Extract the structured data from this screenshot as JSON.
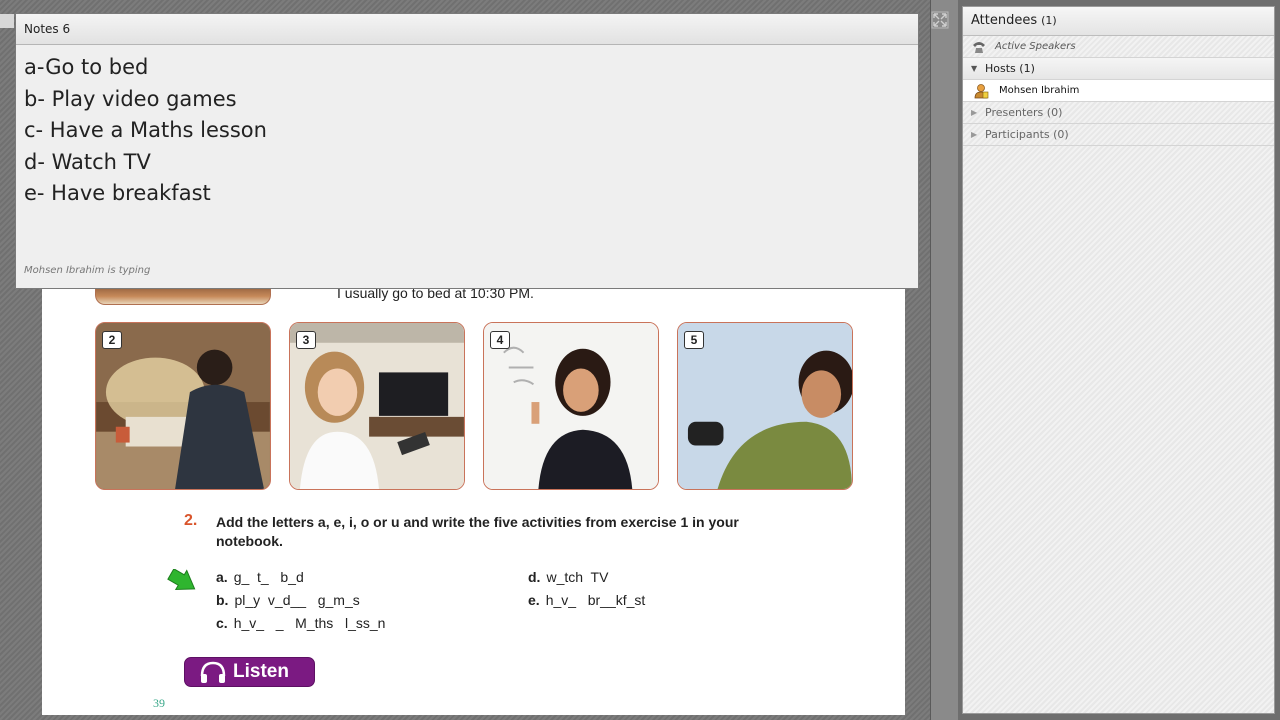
{
  "notes": {
    "title": "Notes 6",
    "lines": [
      "a-Go to bed",
      "b- Play video games",
      "c- Have a Maths lesson",
      "d- Watch TV",
      "e- Have breakfast"
    ],
    "status": "Mohsen  Ibrahim is typing"
  },
  "attendees": {
    "title": "Attendees",
    "count": "(1)",
    "active_speakers": "Active Speakers",
    "hosts": "Hosts (1)",
    "host_name": "Mohsen  Ibrahim",
    "presenters": "Presenters (0)",
    "participants": "Participants (0)"
  },
  "document": {
    "caption": "I usually go to bed at 10:30 PM.",
    "photos": [
      "2",
      "3",
      "4",
      "5"
    ],
    "exercise_number": "2.",
    "exercise_text": "Add the letters a, e, i, o or u and write the five activities from exercise 1 in your notebook.",
    "answers": [
      {
        "letter": "a.",
        "text": "g_  t_   b_d"
      },
      {
        "letter": "b.",
        "text": "pl_y  v_d__   g_m_s"
      },
      {
        "letter": "c.",
        "text": "h_v_   _   M_ths   l_ss_n"
      },
      {
        "letter": "d.",
        "text": "w_tch  TV"
      },
      {
        "letter": "e.",
        "text": "h_v_   br__kf_st"
      }
    ],
    "listen_label": "Listen",
    "page_number": "39"
  },
  "colors": {
    "accent_orange": "#d9542b",
    "listen_purple": "#7b1a82",
    "arrow_green": "#2fb52f"
  }
}
